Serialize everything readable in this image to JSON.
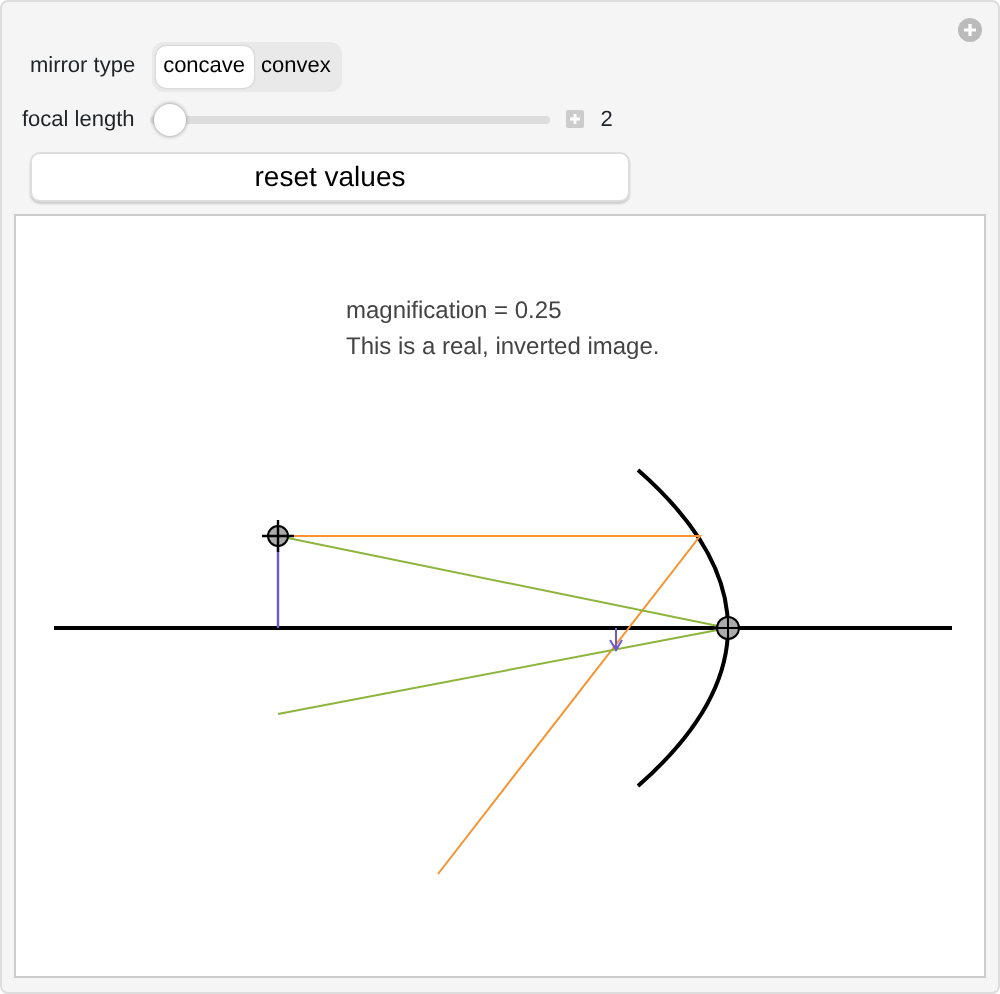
{
  "mirror_type": {
    "label": "mirror type",
    "options": [
      {
        "label": "concave",
        "selected": true
      },
      {
        "label": "convex",
        "selected": false
      }
    ]
  },
  "focal_length": {
    "label": "focal length",
    "level": 0.05,
    "reading": "2"
  },
  "reset_button": "reset values",
  "plot": {
    "magnification": "magnification = 0.25",
    "description": "This is a real, inverted image."
  }
}
